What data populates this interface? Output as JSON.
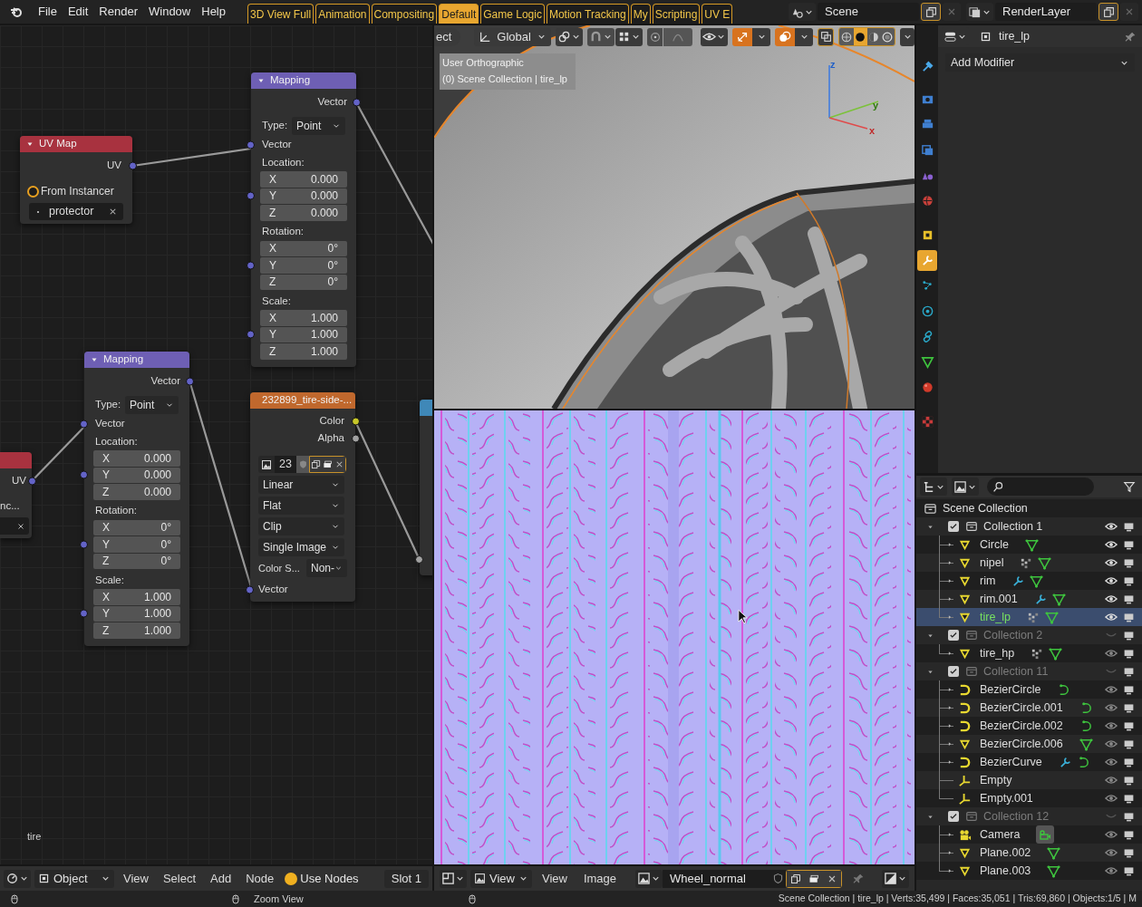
{
  "menu": [
    "File",
    "Edit",
    "Render",
    "Window",
    "Help"
  ],
  "workspaces": [
    {
      "label": "3D View Full",
      "selected": false
    },
    {
      "label": "Animation",
      "selected": false
    },
    {
      "label": "Compositing",
      "selected": false
    },
    {
      "label": "Default",
      "selected": true
    },
    {
      "label": "Game Logic",
      "selected": false
    },
    {
      "label": "Motion Tracking",
      "selected": false
    },
    {
      "label": "My",
      "selected": false
    },
    {
      "label": "Scripting",
      "selected": false
    },
    {
      "label": "UV E",
      "selected": false
    }
  ],
  "scene": "Scene",
  "render_layer": "RenderLayer",
  "node_editor": {
    "nodes": [
      {
        "kind": "uvmap_cut",
        "output": "UV",
        "text": "nc..."
      },
      {
        "kind": "uvmap",
        "title": "UV Map",
        "output": "UV",
        "from_instancer": {
          "label": "From Instancer",
          "checked": false
        },
        "uv_name": "protector"
      },
      {
        "kind": "mapping",
        "title": "Mapping",
        "output": "Vector",
        "type_label": "Type:",
        "type_value": "Point",
        "input": "Vector",
        "groups": [
          {
            "label": "Location:",
            "rows": [
              {
                "axis": "X",
                "value": "0.000"
              },
              {
                "axis": "Y",
                "value": "0.000"
              },
              {
                "axis": "Z",
                "value": "0.000"
              }
            ]
          },
          {
            "label": "Rotation:",
            "rows": [
              {
                "axis": "X",
                "value": "0°"
              },
              {
                "axis": "Y",
                "value": "0°"
              },
              {
                "axis": "Z",
                "value": "0°"
              }
            ]
          },
          {
            "label": "Scale:",
            "rows": [
              {
                "axis": "X",
                "value": "1.000"
              },
              {
                "axis": "Y",
                "value": "1.000"
              },
              {
                "axis": "Z",
                "value": "1.000"
              }
            ]
          }
        ]
      },
      {
        "kind": "mapping",
        "title": "Mapping",
        "output": "Vector",
        "type_label": "Type:",
        "type_value": "Point",
        "input": "Vector",
        "groups": [
          {
            "label": "Location:",
            "rows": [
              {
                "axis": "X",
                "value": "0.000"
              },
              {
                "axis": "Y",
                "value": "0.000"
              },
              {
                "axis": "Z",
                "value": "0.000"
              }
            ]
          },
          {
            "label": "Rotation:",
            "rows": [
              {
                "axis": "X",
                "value": "0°"
              },
              {
                "axis": "Y",
                "value": "0°"
              },
              {
                "axis": "Z",
                "value": "0°"
              }
            ]
          },
          {
            "label": "Scale:",
            "rows": [
              {
                "axis": "X",
                "value": "1.000"
              },
              {
                "axis": "Y",
                "value": "1.000"
              },
              {
                "axis": "Z",
                "value": "1.000"
              }
            ]
          }
        ]
      },
      {
        "kind": "image",
        "title": "232899_tire-side-...",
        "outputs": [
          {
            "label": "Color",
            "kind": "color"
          },
          {
            "label": "Alpha",
            "kind": "float"
          }
        ],
        "users": "23",
        "options": [
          "Linear",
          "Flat",
          "Clip",
          "Single Image"
        ],
        "color_space": {
          "label": "Color S...",
          "value": "Non-"
        },
        "input": "Vector"
      },
      {
        "kind": "vector_cut"
      }
    ],
    "frame_label": "tire"
  },
  "node_header": {
    "mode": "Object",
    "menus": [
      "View",
      "Select",
      "Add",
      "Node"
    ],
    "use_nodes": {
      "label": "Use Nodes",
      "checked": true
    },
    "slot": "Slot 1"
  },
  "viewport": {
    "select_label": "ect",
    "orientation": "Global",
    "toggles": [
      {
        "kind": "gizmo",
        "on": true
      },
      {
        "kind": "overlay",
        "on": true
      }
    ],
    "shading": [
      {
        "kind": "wireframe",
        "selected": false
      },
      {
        "kind": "solid",
        "selected": true
      },
      {
        "kind": "material",
        "selected": false
      },
      {
        "kind": "rendered",
        "selected": false
      }
    ],
    "view_name": "User Orthographic",
    "info": "(0) Scene Collection | tire_lp",
    "axes": [
      "z",
      "y",
      "x"
    ]
  },
  "image_header": {
    "mode": "View",
    "menus": [
      "View",
      "Image"
    ],
    "image_name": "Wheel_normal"
  },
  "properties": {
    "object_name": "tire_lp",
    "add_modifier": "Add Modifier",
    "tabs": [
      {
        "kind": "tool",
        "selected": false
      },
      {
        "kind": "render",
        "selected": false
      },
      {
        "kind": "output",
        "selected": false
      },
      {
        "kind": "view_layer",
        "selected": false
      },
      {
        "kind": "scene",
        "selected": false
      },
      {
        "kind": "world",
        "selected": false
      },
      {
        "kind": "object",
        "selected": false
      },
      {
        "kind": "modifier",
        "selected": true
      },
      {
        "kind": "particles",
        "selected": false
      },
      {
        "kind": "physics",
        "selected": false
      },
      {
        "kind": "constraints",
        "selected": false
      },
      {
        "kind": "data",
        "selected": false
      },
      {
        "kind": "material",
        "selected": false
      },
      {
        "kind": "texture",
        "selected": false
      }
    ]
  },
  "outliner": {
    "root": {
      "label": "Scene Collection",
      "children": [
        {
          "kind": "collection",
          "label": "Collection 1",
          "expanded": true,
          "checked": true,
          "visible": true,
          "children": [
            {
              "kind": "mesh",
              "label": "Circle",
              "expanded": false,
              "selected": false,
              "extras": [
                {
                  "kind": "mesh_data"
                }
              ]
            },
            {
              "kind": "mesh",
              "label": "nipel",
              "expanded": false,
              "selected": false,
              "extras": [
                {
                  "kind": "particles"
                },
                {
                  "kind": "mesh_data"
                }
              ]
            },
            {
              "kind": "mesh",
              "label": "rim",
              "expanded": false,
              "selected": false,
              "extras": [
                {
                  "kind": "modifier"
                },
                {
                  "kind": "mesh_data"
                }
              ]
            },
            {
              "kind": "mesh",
              "label": "rim.001",
              "expanded": false,
              "selected": false,
              "extras": [
                {
                  "kind": "modifier"
                },
                {
                  "kind": "mesh_data"
                }
              ]
            },
            {
              "kind": "mesh",
              "label": "tire_lp",
              "expanded": false,
              "selected": true,
              "extras": [
                {
                  "kind": "particles"
                },
                {
                  "kind": "mesh_data"
                }
              ]
            }
          ]
        },
        {
          "kind": "collection",
          "label": "Collection 2",
          "expanded": true,
          "checked": true,
          "visible": false,
          "children": [
            {
              "kind": "mesh",
              "label": "tire_hp",
              "expanded": false,
              "selected": false,
              "extras": [
                {
                  "kind": "particles"
                },
                {
                  "kind": "mesh_data"
                }
              ]
            }
          ]
        },
        {
          "kind": "collection",
          "label": "Collection 11",
          "expanded": true,
          "checked": true,
          "visible": false,
          "children": [
            {
              "kind": "curve",
              "label": "BezierCircle",
              "expanded": false,
              "selected": false,
              "extras": [
                {
                  "kind": "curve_data"
                }
              ]
            },
            {
              "kind": "curve",
              "label": "BezierCircle.001",
              "expanded": false,
              "selected": false,
              "extras": [
                {
                  "kind": "curve_data"
                }
              ]
            },
            {
              "kind": "curve",
              "label": "BezierCircle.002",
              "expanded": false,
              "selected": false,
              "extras": [
                {
                  "kind": "curve_data"
                }
              ]
            },
            {
              "kind": "mesh",
              "label": "BezierCircle.006",
              "expanded": false,
              "selected": false,
              "extras": [
                {
                  "kind": "mesh_data"
                }
              ]
            },
            {
              "kind": "curve",
              "label": "BezierCurve",
              "expanded": false,
              "selected": false,
              "extras": [
                {
                  "kind": "modifier"
                },
                {
                  "kind": "curve_data"
                }
              ]
            },
            {
              "kind": "empty",
              "label": "Empty",
              "selected": false
            },
            {
              "kind": "empty",
              "label": "Empty.001",
              "selected": false
            }
          ]
        },
        {
          "kind": "collection",
          "label": "Collection 12",
          "expanded": true,
          "checked": true,
          "visible": false,
          "children": [
            {
              "kind": "camera",
              "label": "Camera",
              "expanded": false,
              "selected": false,
              "extras": [
                {
                  "kind": "camera_data"
                }
              ]
            },
            {
              "kind": "mesh",
              "label": "Plane.002",
              "expanded": false,
              "selected": false,
              "extras": [
                {
                  "kind": "mesh_data"
                }
              ]
            },
            {
              "kind": "mesh",
              "label": "Plane.003",
              "expanded": false,
              "selected": false,
              "extras": [
                {
                  "kind": "mesh_data"
                }
              ]
            }
          ]
        }
      ]
    }
  },
  "status_bar": {
    "hint": "Zoom View",
    "stats": "Scene Collection | tire_lp | Verts:35,499 | Faces:35,051 | Tris:69,860 | Objects:1/5 | M"
  }
}
